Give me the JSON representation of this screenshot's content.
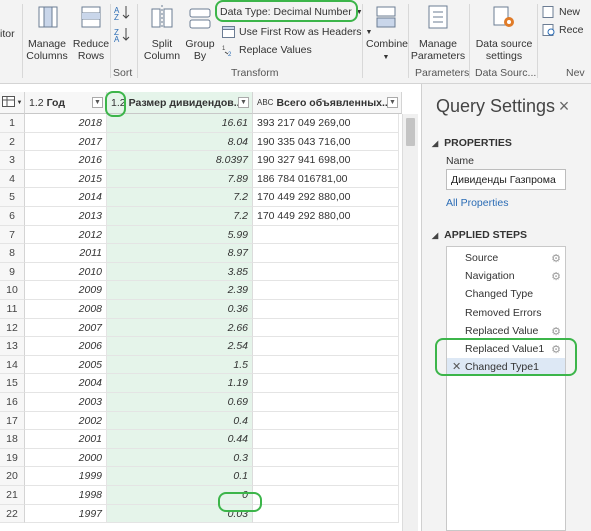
{
  "ribbon": {
    "editor_fragment": "itor",
    "manage_columns": [
      "Manage",
      "Columns"
    ],
    "reduce_rows": [
      "Reduce",
      "Rows"
    ],
    "sort_label": "Sort",
    "split_column": [
      "Split",
      "Column"
    ],
    "group_by": [
      "Group",
      "By"
    ],
    "data_type": "Data Type: Decimal Number",
    "first_row_headers": "Use First Row as Headers",
    "replace_values": "Replace Values",
    "transform_label": "Transform",
    "combine": "Combine",
    "manage_parameters": [
      "Manage",
      "Parameters"
    ],
    "parameters_label": "Parameters",
    "data_source_settings": [
      "Data source",
      "settings"
    ],
    "data_sources_label": "Data Sourc...",
    "new_fragment": "New",
    "recent_fragment": "Rece",
    "nev_fragment": "Nev",
    "accent_green": "#3cb54a"
  },
  "grid": {
    "columns": [
      {
        "type_icon": "1.2",
        "name": "Год"
      },
      {
        "type_icon": "1.2",
        "name": "Размер дивидендов..."
      },
      {
        "type_icon": "ABC",
        "name": "Всего объявленных..."
      }
    ],
    "rows": [
      {
        "n": "1",
        "year": "2018",
        "div": "16.61",
        "total": "393 217 049 269,00"
      },
      {
        "n": "2",
        "year": "2017",
        "div": "8.04",
        "total": "190 335 043 716,00"
      },
      {
        "n": "3",
        "year": "2016",
        "div": "8.0397",
        "total": "190 327 941 698,00"
      },
      {
        "n": "4",
        "year": "2015",
        "div": "7.89",
        "total": "186 784 016781,00"
      },
      {
        "n": "5",
        "year": "2014",
        "div": "7.2",
        "total": "170 449 292 880,00"
      },
      {
        "n": "6",
        "year": "2013",
        "div": "7.2",
        "total": "170 449 292 880,00"
      },
      {
        "n": "7",
        "year": "2012",
        "div": "5.99",
        "total": ""
      },
      {
        "n": "8",
        "year": "2011",
        "div": "8.97",
        "total": ""
      },
      {
        "n": "9",
        "year": "2010",
        "div": "3.85",
        "total": ""
      },
      {
        "n": "10",
        "year": "2009",
        "div": "2.39",
        "total": ""
      },
      {
        "n": "11",
        "year": "2008",
        "div": "0.36",
        "total": ""
      },
      {
        "n": "12",
        "year": "2007",
        "div": "2.66",
        "total": ""
      },
      {
        "n": "13",
        "year": "2006",
        "div": "2.54",
        "total": ""
      },
      {
        "n": "14",
        "year": "2005",
        "div": "1.5",
        "total": ""
      },
      {
        "n": "15",
        "year": "2004",
        "div": "1.19",
        "total": ""
      },
      {
        "n": "16",
        "year": "2003",
        "div": "0.69",
        "total": ""
      },
      {
        "n": "17",
        "year": "2002",
        "div": "0.4",
        "total": ""
      },
      {
        "n": "18",
        "year": "2001",
        "div": "0.44",
        "total": ""
      },
      {
        "n": "19",
        "year": "2000",
        "div": "0.3",
        "total": ""
      },
      {
        "n": "20",
        "year": "1999",
        "div": "0.1",
        "total": ""
      },
      {
        "n": "21",
        "year": "1998",
        "div": "0",
        "total": ""
      },
      {
        "n": "22",
        "year": "1997",
        "div": "0.03",
        "total": ""
      }
    ]
  },
  "query_settings": {
    "title": "Query Settings",
    "close": "×",
    "properties_header": "PROPERTIES",
    "name_label": "Name",
    "name_value": "Дивиденды Газпрома",
    "all_properties": "All Properties",
    "applied_steps_header": "APPLIED STEPS",
    "steps": [
      {
        "label": "Source",
        "gear": true,
        "x": false
      },
      {
        "label": "Navigation",
        "gear": true,
        "x": false
      },
      {
        "label": "Changed Type",
        "gear": false,
        "x": false
      },
      {
        "label": "Removed Errors",
        "gear": false,
        "x": false
      },
      {
        "label": "Replaced Value",
        "gear": true,
        "x": false
      },
      {
        "label": "Replaced Value1",
        "gear": true,
        "x": false
      },
      {
        "label": "Changed Type1",
        "gear": false,
        "x": true,
        "active": true
      }
    ]
  }
}
